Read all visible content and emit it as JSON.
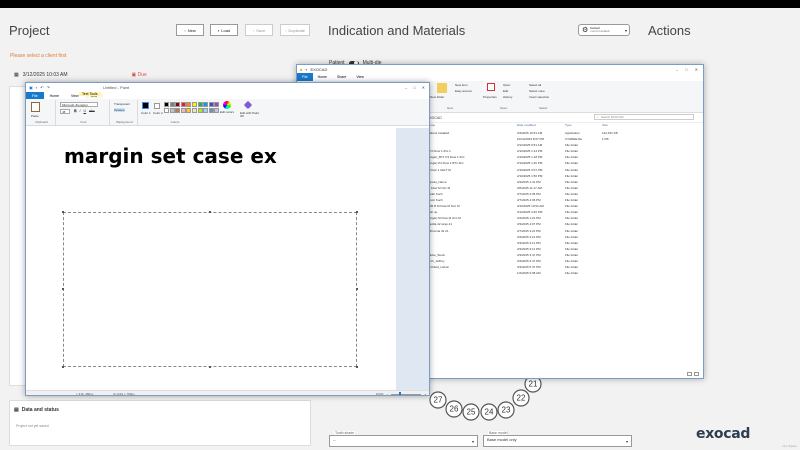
{
  "exocad": {
    "project_title": "Project",
    "indication_title": "Indication and Materials",
    "actions_title": "Actions",
    "buttons": {
      "new": "New",
      "load": "Load",
      "save": "Save",
      "duplicate": "Duplicate"
    },
    "warning": "Please select a client first",
    "date": "3/12/2025 10:03 AM",
    "due_label": "Due",
    "patient_label": "Patient",
    "multi_die_label": "Multi-die",
    "default_line1": "Default",
    "default_line2": "current default",
    "data_status_title": "Data and status",
    "data_status_note": "Project not yet saved",
    "tooth_shade_label": "Tooth shade",
    "tooth_shade_value": "--",
    "base_model_label": "Base model",
    "base_model_value": "Base model only",
    "logo": "exocad",
    "version": "v3.1 Rijeka",
    "teeth": [
      "21",
      "22",
      "23",
      "24",
      "25",
      "26",
      "27"
    ]
  },
  "paint": {
    "title": "Untitled - Paint",
    "tabs": [
      "File",
      "Home",
      "View"
    ],
    "text_tools_tab": "Text Tools",
    "text_tab": "Text",
    "canvas_text": "margin set case ex",
    "ribbon": {
      "clipboard": "Clipboard",
      "paste": "Paste",
      "font": "Font",
      "font_name": "Microsoft JhengHei",
      "font_size": "48",
      "background": "Background",
      "opaque": "Opaque",
      "transparent": "Transparent",
      "colors": "Colors",
      "color1": "Color 1",
      "color2": "Color 2",
      "edit_colors": "Edit colors",
      "edit_paint3d": "Edit with Paint 3D"
    },
    "status": {
      "pos": "316, 280px",
      "size": "1219 × 789px",
      "zoom": "100%"
    },
    "palette": [
      "#000000",
      "#7f7f7f",
      "#880015",
      "#ed1c24",
      "#ff7f27",
      "#fff200",
      "#22b14c",
      "#00a2e8",
      "#3f48cc",
      "#a349a4",
      "#ffffff",
      "#c3c3c3",
      "#b97a57",
      "#ffaec9",
      "#ffc90e",
      "#efe4b0",
      "#b5e61d",
      "#99d9ea",
      "#7092be",
      "#c8bfe7"
    ]
  },
  "explorer": {
    "title": "EXOCAD",
    "tabs": [
      "File",
      "Home",
      "Share",
      "View"
    ],
    "ribbon": {
      "new_folder": "New folder",
      "new_item": "New item",
      "easy_access": "Easy access",
      "properties": "Properties",
      "open": "Open",
      "edit": "Edit",
      "history": "History",
      "select_all": "Select all",
      "select_none": "Select none",
      "invert_selection": "Invert selection",
      "groups": [
        "New",
        "Open",
        "Select"
      ]
    },
    "address": "EXOCAD",
    "search_placeholder": "Search EXOCAD",
    "columns": [
      "Name",
      "Date modified",
      "Type",
      "Size"
    ],
    "rows": [
      {
        "name": "Addons Installed",
        "date": "3/3/2025 10:51 AM",
        "type": "Application",
        "size": "122,151 KB"
      },
      {
        "name": "",
        "date": "10/12/2023 8:07 PM",
        "type": "CTHREE.file",
        "size": "1 KB"
      },
      {
        "name": "",
        "date": "3/12/2025 9:51 AM",
        "type": "File folder",
        "size": ""
      },
      {
        "name": "ll P4 Flow 1 Zirc 1",
        "date": "2/10/2025 1:14 PM",
        "type": "File folder",
        "size": ""
      },
      {
        "name": "(Single)_BT1 P4 Flow 1 Zirc",
        "date": "2/19/2025 1:18 PM",
        "type": "File folder",
        "size": ""
      },
      {
        "name": "(Single) P4 Flow 1 BT1 Zirc",
        "date": "2/19/2025 1:20 PM",
        "type": "File folder",
        "size": ""
      },
      {
        "name": "M Flow 1 CELT M",
        "date": "2/19/2025 3:07 PM",
        "type": "File folder",
        "size": ""
      },
      {
        "name": "",
        "date": "2/19/2025 1:56 PM",
        "type": "File folder",
        "size": ""
      },
      {
        "name": "Bypass_Name",
        "date": "3/4/2025 1:41 PM",
        "type": "File folder",
        "size": ""
      },
      {
        "name": "11 Flow M Occ M",
        "date": "3/6/2025 11:17 AM",
        "type": "File folder",
        "size": ""
      },
      {
        "name": "Sarah Koch",
        "date": "3/7/2025 2:35 PM",
        "type": "File folder",
        "size": ""
      },
      {
        "name": "Jacob Koch",
        "date": "3/7/2025 2:36 PM",
        "type": "File folder",
        "size": ""
      },
      {
        "name": "EDB R M Flow M Occ M",
        "date": "3/10/2025 10:53 AM",
        "type": "File folder",
        "size": ""
      },
      {
        "name": "Web up",
        "date": "3/10/2025 4:40 PM",
        "type": "File folder",
        "size": ""
      },
      {
        "name": "(Single) M Flow M Occ M",
        "date": "3/4/2025 1:21 PM",
        "type": "File folder",
        "size": ""
      },
      {
        "name": "Maxilla 42 wrap 41",
        "date": "3/3/2025 4:07 PM",
        "type": "File folder",
        "size": ""
      },
      {
        "name": "2 Zirconia 32 21",
        "date": "3/7/2025 3:21 PM",
        "type": "File folder",
        "size": ""
      },
      {
        "name": "",
        "date": "3/3/2025 4:21 PM",
        "type": "File folder",
        "size": ""
      },
      {
        "name": "",
        "date": "3/3/2025 3:11 PM",
        "type": "File folder",
        "size": ""
      },
      {
        "name": "",
        "date": "3/3/2025 3:11 PM",
        "type": "File folder",
        "size": ""
      },
      {
        "name": "Adobe_Stock",
        "date": "3/3/2025 3:47 PM",
        "type": "File folder",
        "size": ""
      },
      {
        "name": "Birch_Jeffrey",
        "date": "3/3/2025 3:47 PM",
        "type": "File folder",
        "size": ""
      },
      {
        "name": "Birchfeld_Lisbon",
        "date": "3/3/2025 5:47 PM",
        "type": "File folder",
        "size": ""
      },
      {
        "name": "",
        "date": "1/2/2025 9:08 AM",
        "type": "File folder",
        "size": ""
      }
    ]
  }
}
